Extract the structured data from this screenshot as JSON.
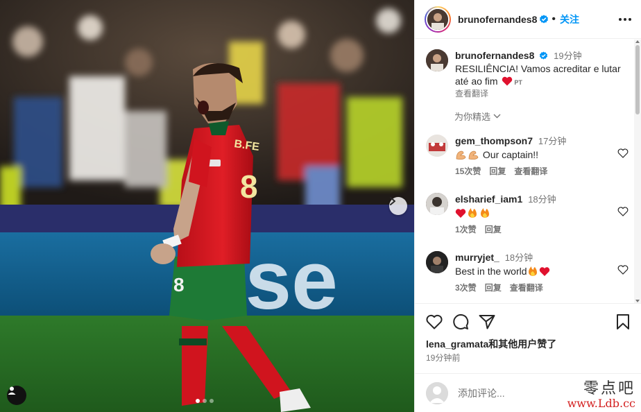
{
  "post": {
    "author": "brunofernandes8",
    "follow_label": "关注",
    "caption_time": "19分钟",
    "caption_text": "RESILIÊNCIA! Vamos acreditar e lutar até ao fim",
    "caption_lang": "PT",
    "see_translation": "查看翻译",
    "for_you_label": "为你精选",
    "photo_text": {
      "jersey_name": "B.FE",
      "jersey_number": "8",
      "shorts_number": "8",
      "board_text": "ise"
    }
  },
  "comments": [
    {
      "user": "gem_thompson7",
      "time": "17分钟",
      "emoji": "💪💪",
      "text": "Our captain!!",
      "likes": "15次赞",
      "reply": "回复",
      "translate": "查看翻译"
    },
    {
      "user": "elsharief_iam1",
      "time": "18分钟",
      "emoji": "❤️🔥🔥",
      "text": "",
      "likes": "1次赞",
      "reply": "回复"
    },
    {
      "user": "murryjet_",
      "time": "18分钟",
      "emoji": "",
      "text": "Best in the world",
      "trail_emoji": "🔥❤️",
      "likes": "3次赞",
      "reply": "回复",
      "translate": "查看翻译"
    }
  ],
  "footer": {
    "liked_by_user": "lena_gramata",
    "liked_by_suffix": "和其他用户赞了",
    "posted_time": "19分钟前",
    "add_comment_placeholder": "添加评论..."
  },
  "watermark": {
    "cn": "零点吧",
    "url": "www.Ldb.cc"
  },
  "carousel": {
    "slide": 1,
    "count": 3
  },
  "colors": {
    "accent": "#0095f6",
    "heart": "#ed4956",
    "verified": "#0095f6",
    "jersey": "#d4161f"
  }
}
